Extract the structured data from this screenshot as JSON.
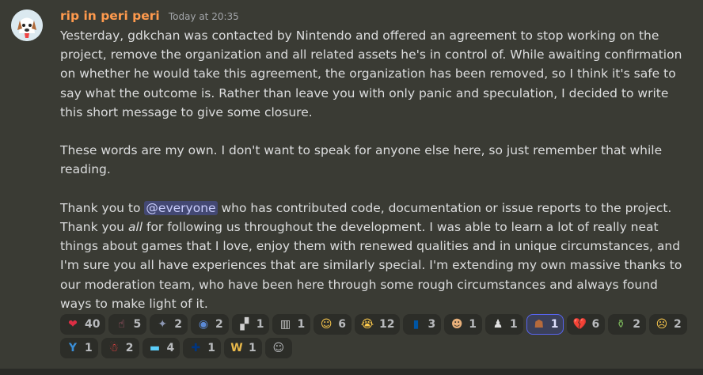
{
  "message": {
    "username": "rip in peri peri",
    "timestamp": "Today at 20:35",
    "paragraphs": [
      "Yesterday, gdkchan was contacted by Nintendo and offered an agreement to stop working on the project, remove the organization and all related assets he's in control of. While awaiting confirmation on whether he would take this agreement, the organization has been removed, so I think it's safe to say what the outcome is. Rather than leave you with only panic and speculation, I decided to write this short message to give some closure.",
      "These words are my own. I don't want to speak for anyone else here, so just remember that while reading."
    ],
    "p3_before_mention": "Thank you to ",
    "mention": "@everyone",
    "p3_after_mention": " who has contributed code, documentation or issue reports to the project. Thank you ",
    "p3_emphasis": "all",
    "p3_rest": " for following us throughout the development. I was able to learn a lot of really neat things about games that I love, enjoy them with renewed qualities and in unique circumstances, and I'm sure you all have experiences that are similarly special. I'm extending my own massive thanks to our moderation team, who have been here through some rough circumstances and always found ways to make light of it."
  },
  "reactions": [
    {
      "icon": "heart-icon",
      "glyph": "❤",
      "color": "#dd2e44",
      "count": "40"
    },
    {
      "icon": "pointing-figure-icon",
      "glyph": "☝",
      "color": "#c0607a",
      "count": "5"
    },
    {
      "icon": "fireworks-icon",
      "glyph": "✦",
      "color": "#8c97b3",
      "count": "2"
    },
    {
      "icon": "eye-icon",
      "glyph": "◉",
      "color": "#5b8ad6",
      "count": "2"
    },
    {
      "icon": "dark-sticker-icon",
      "glyph": "▞",
      "color": "#cfcfcf",
      "count": "1"
    },
    {
      "icon": "trash-can-icon",
      "glyph": "▥",
      "color": "#c9c9c9",
      "count": "1"
    },
    {
      "icon": "relieved-face-icon",
      "glyph": "☺",
      "color": "#ffcc4d",
      "count": "6"
    },
    {
      "icon": "crying-face-icon",
      "glyph": "😭",
      "color": "#ffcc4d",
      "count": "12"
    },
    {
      "icon": "flag-france-icon",
      "glyph": "▮",
      "color": "#0055a4",
      "count": "3"
    },
    {
      "icon": "character-sticker-icon",
      "glyph": "☻",
      "color": "#e8b07a",
      "count": "1"
    },
    {
      "icon": "chess-piece-icon",
      "glyph": "♟",
      "color": "#e0e0e0",
      "count": "1"
    },
    {
      "icon": "dog-sticker-icon",
      "glyph": "☗",
      "color": "#b56a3c",
      "count": "1",
      "me": true
    },
    {
      "icon": "broken-heart-icon",
      "glyph": "💔",
      "color": "#dd2e44",
      "count": "6"
    },
    {
      "icon": "bottle-icon",
      "glyph": "⚱",
      "color": "#78b159",
      "count": "2"
    },
    {
      "icon": "sad-face-icon",
      "glyph": "☹",
      "color": "#ffcc4d",
      "count": "2"
    },
    {
      "icon": "y-badge-icon",
      "glyph": "Y",
      "color": "#3a8fd8",
      "count": "1"
    },
    {
      "icon": "santa-sticker-icon",
      "glyph": "☃",
      "color": "#e44",
      "count": "2"
    },
    {
      "icon": "flag-trans-icon",
      "glyph": "▬",
      "color": "#5bcefa",
      "count": "4"
    },
    {
      "icon": "flag-finland-icon",
      "glyph": "✚",
      "color": "#003580",
      "count": "1"
    },
    {
      "icon": "w-coin-icon",
      "glyph": "W",
      "color": "#e8b84a",
      "count": "1"
    }
  ],
  "add_reaction": {
    "icon": "add-reaction-icon",
    "glyph": "☺"
  }
}
